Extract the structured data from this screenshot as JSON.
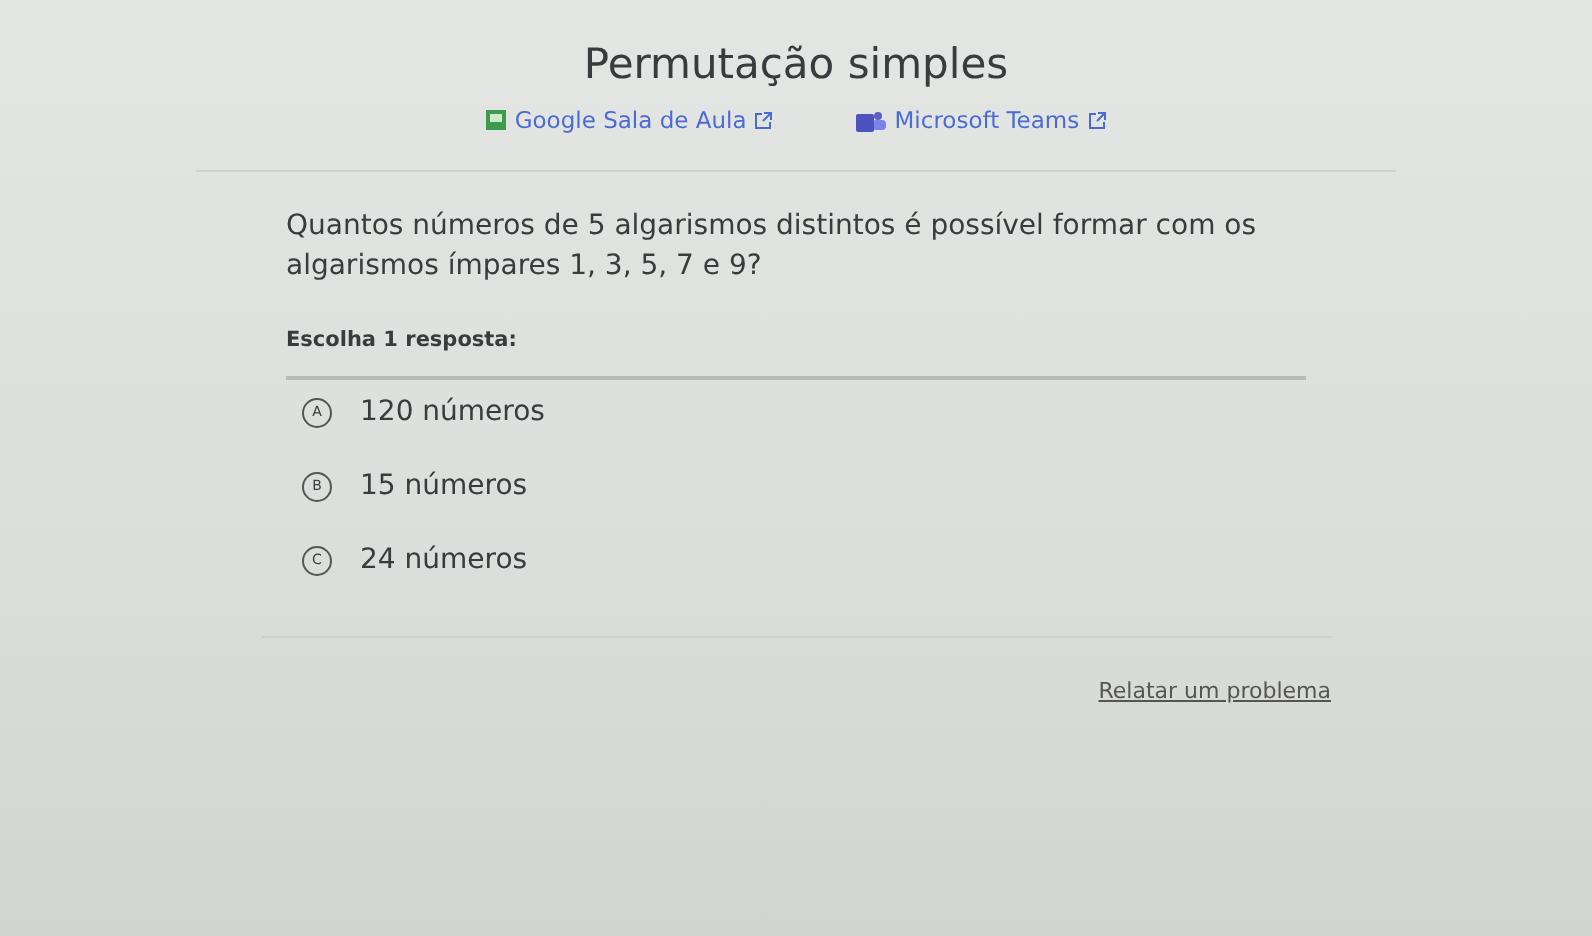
{
  "title": "Permutação simples",
  "links": [
    {
      "kind": "classroom",
      "label": "Google Sala de Aula"
    },
    {
      "kind": "teams",
      "label": "Microsoft Teams"
    }
  ],
  "question": "Quantos números de 5 algarismos distintos é possível formar com os algarismos ímpares 1, 3, 5, 7 e 9?",
  "prompt": "Escolha 1 resposta:",
  "options": [
    {
      "letter": "A",
      "label": "120 números",
      "selected": false
    },
    {
      "letter": "B",
      "label": "15 números",
      "selected": false
    },
    {
      "letter": "C",
      "label": "24 números",
      "selected": false
    }
  ],
  "report_link": "Relatar um problema"
}
